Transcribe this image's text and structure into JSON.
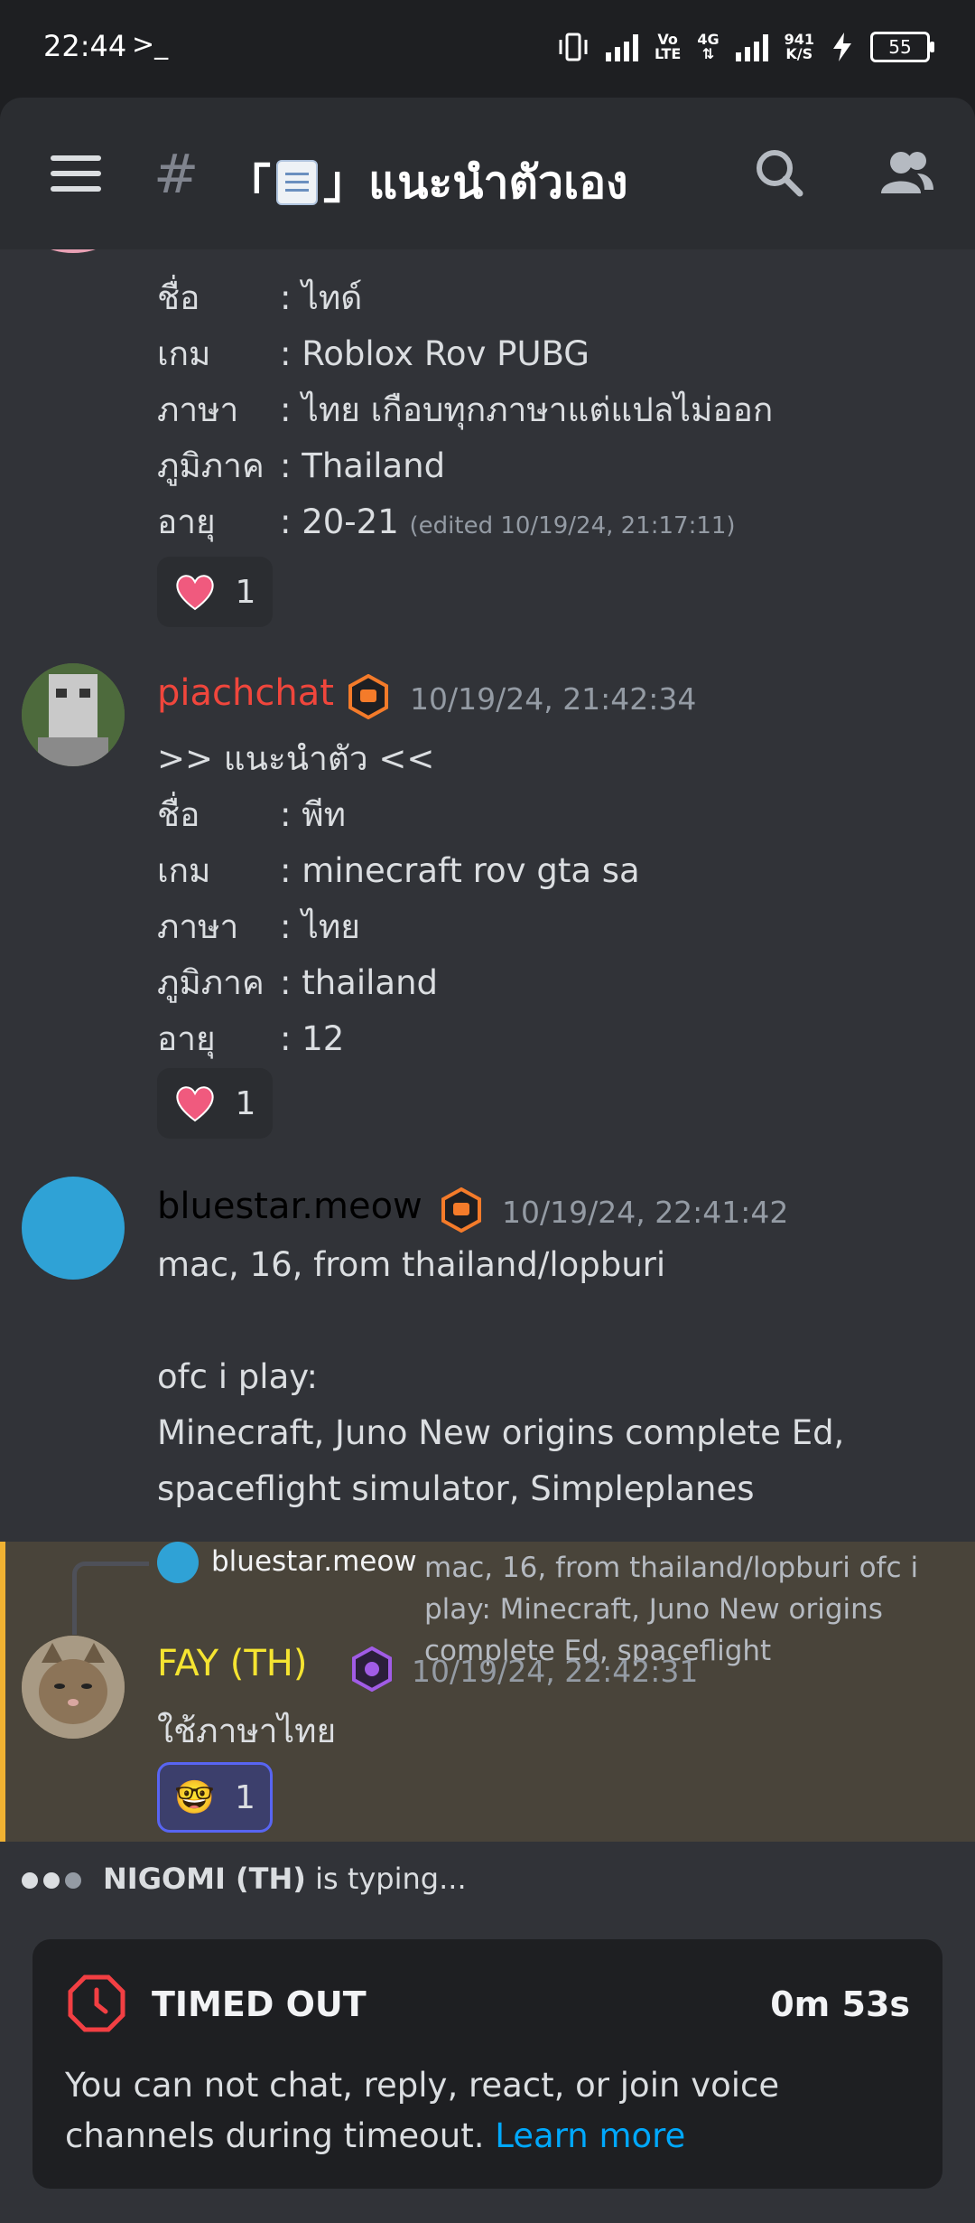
{
  "status_bar": {
    "time": "22:44",
    "terminal_glyph": ">_",
    "net_top": "Vo",
    "net_bottom": "LTE",
    "net2_top": "4G",
    "speed_top": "941",
    "speed_bottom": "K/S",
    "battery": "55"
  },
  "header": {
    "hash": "#",
    "title_left": "「",
    "title_right": "」แนะนำตัวเอง"
  },
  "messages": [
    {
      "lines": [
        {
          "label": "ชื่อ",
          "value": ": ไทด์"
        },
        {
          "label": "เกม",
          "value": ": Roblox Rov PUBG"
        },
        {
          "label": "ภาษา",
          "value": ": ไทย เกือบทุกภาษาแต่แปลไม่ออก"
        },
        {
          "label": "ภูมิภาค",
          "value": ": Thailand"
        },
        {
          "label": "อายุ",
          "value": ": 20-21"
        }
      ],
      "edited": "(edited 10/19/24, 21:17:11)",
      "reaction_count": "1"
    },
    {
      "username": "piachchat",
      "username_color": "#f0463c",
      "timestamp": "10/19/24, 21:42:34",
      "intro": ">> แนะนำตัว <<",
      "lines": [
        {
          "label": "ชื่อ",
          "value": ": พีท"
        },
        {
          "label": "เกม",
          "value": ": minecraft rov gta sa"
        },
        {
          "label": "ภาษา",
          "value": ": ไทย"
        },
        {
          "label": "ภูมิภาค",
          "value": ": thailand"
        },
        {
          "label": "อายุ",
          "value": ": 12"
        }
      ],
      "reaction_count": "1"
    },
    {
      "username": "bluestar.meow",
      "username_color": "#000000",
      "timestamp": "10/19/24, 22:41:42",
      "lines": [
        "mac, 16, from thailand/lopburi",
        "",
        "ofc i play:",
        "Minecraft, Juno New origins complete Ed,",
        "spaceflight simulator, Simpleplanes"
      ]
    },
    {
      "reply_to": "bluestar.meow",
      "reply_preview": "mac, 16, from thailand/lopburi  ofc i play: Minecraft, Juno New origins complete Ed, spaceflight",
      "username": "FAY (TH)",
      "username_color": "#f5e431",
      "timestamp": "10/19/24, 22:42:31",
      "text": "ใช้ภาษาไทย",
      "reaction_emoji": "🤓",
      "reaction_count": "1"
    }
  ],
  "typing": {
    "user": "NIGOMI (TH)",
    "suffix": "is typing..."
  },
  "timeout": {
    "title": "TIMED OUT",
    "timer": "0m 53s",
    "body": "You can not chat, reply, react, or join voice channels during timeout.",
    "link": "Learn more"
  }
}
